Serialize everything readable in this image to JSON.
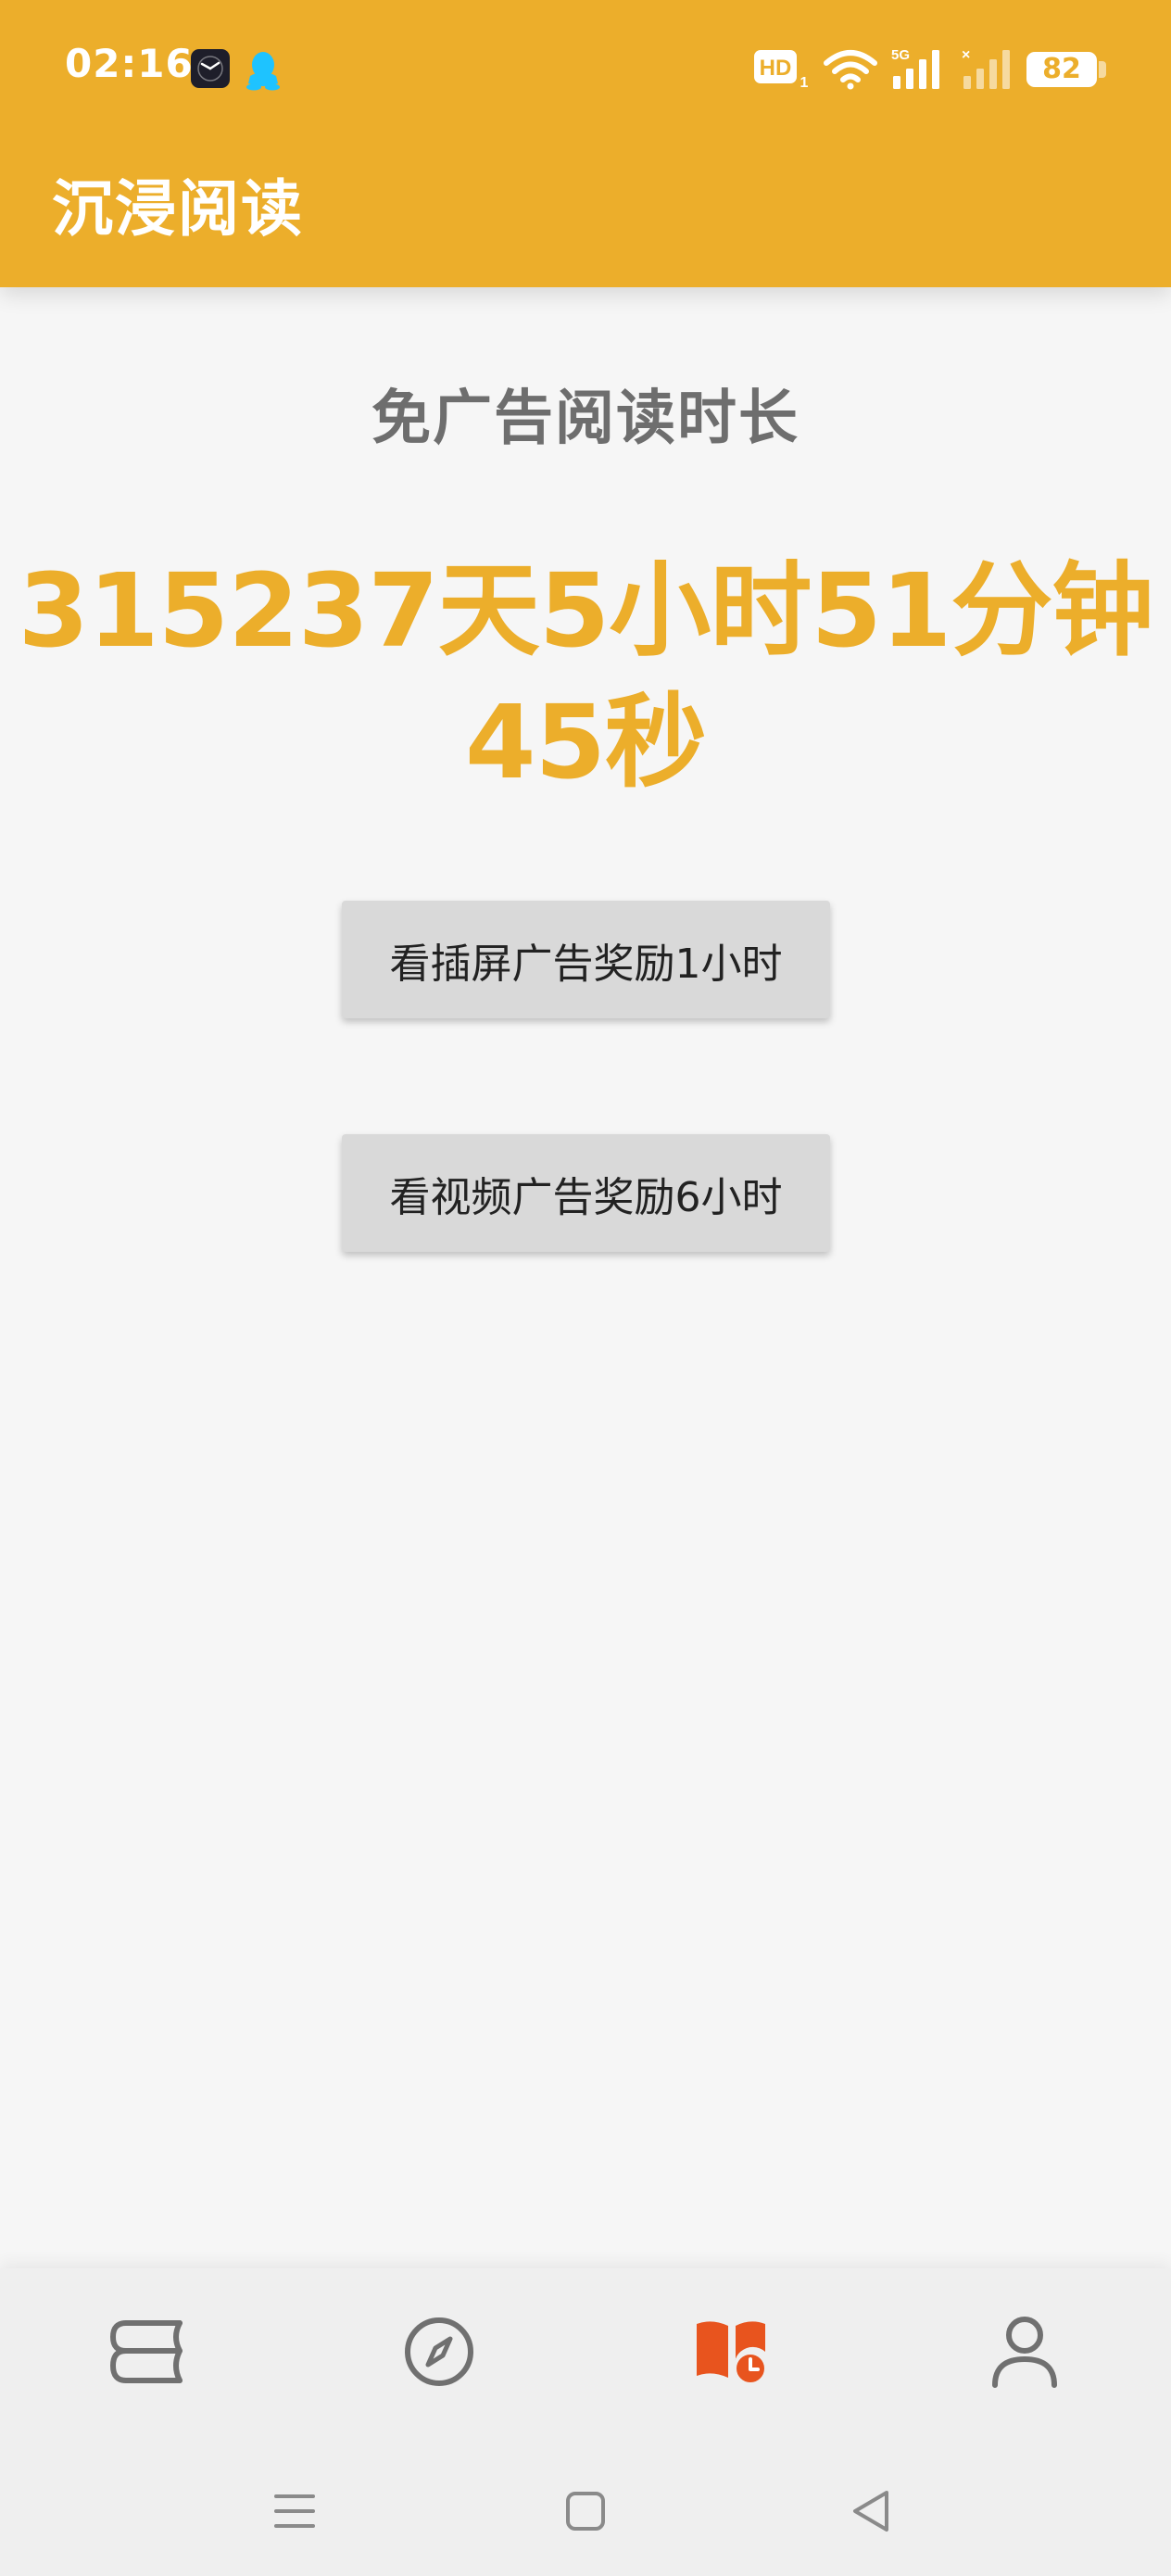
{
  "status_bar": {
    "time": "02:16",
    "battery": "82",
    "icons": [
      "clock-app-icon",
      "qq-penguin-icon",
      "hd-voice-icon",
      "wifi-icon",
      "signal-5g-icon",
      "signal-no-sim-icon",
      "battery-icon"
    ]
  },
  "toolbar": {
    "title": "沉浸阅读"
  },
  "main": {
    "section_title": "免广告阅读时长",
    "countdown": "315237天5小时51分钟45秒",
    "buttons": {
      "interstitial_label": "看插屏广告奖励1小时",
      "video_label": "看视频广告奖励6小时"
    }
  },
  "bottom_nav": {
    "items": [
      "bookshelf-icon",
      "compass-icon",
      "reading-time-icon",
      "profile-icon"
    ],
    "active": "reading-time-icon",
    "colors": {
      "active": "#e8541e",
      "inactive": "#707070"
    }
  },
  "colors": {
    "accent": "#ecae2b",
    "background": "#f6f6f6",
    "button_bg": "#d9d9d9"
  }
}
